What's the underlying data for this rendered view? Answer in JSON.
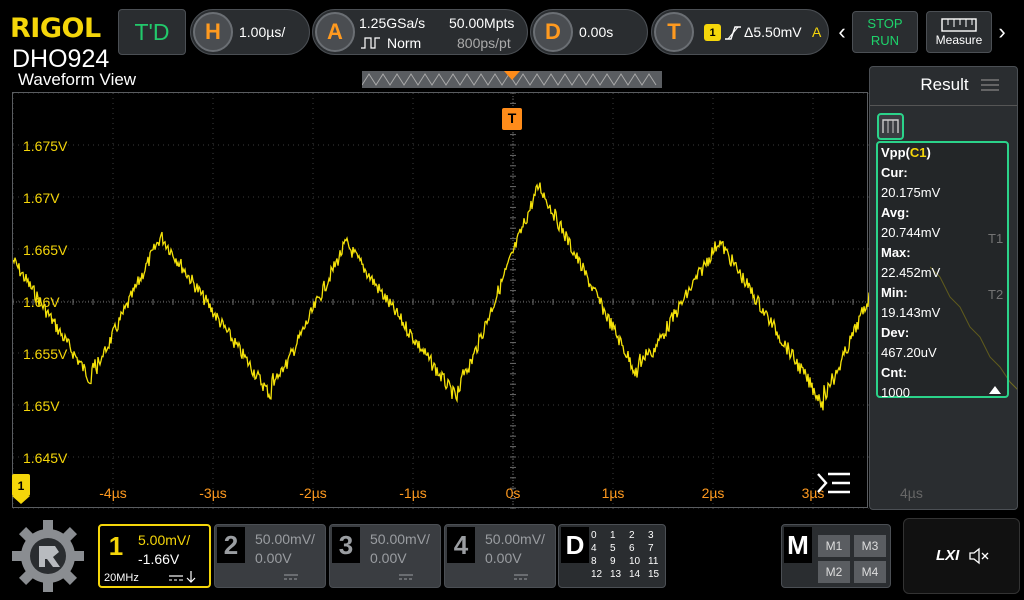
{
  "brand": {
    "logo": "RIGOL",
    "model": "DHO924"
  },
  "header": {
    "td_label": "T'D",
    "horizontal": {
      "key": "H",
      "timebase": "1.00µs/"
    },
    "acquire": {
      "key": "A",
      "sample_rate": "1.25GSa/s",
      "mode": "Norm",
      "memory_depth": "50.00Mpts",
      "sample_interval": "800ps/pt"
    },
    "delay": {
      "key": "D",
      "value": "0.00s"
    },
    "trigger": {
      "key": "T",
      "source": "1",
      "level": "Δ5.50mV",
      "sweep": "A"
    },
    "stop_label": "STOP",
    "run_label": "RUN",
    "measure_label": "Measure"
  },
  "waveform_view": {
    "title": "Waveform View",
    "trigger_badge": "T",
    "channel_marker": "1",
    "y_labels": [
      "1.675V",
      "1.67V",
      "1.665V",
      "1.66V",
      "1.655V",
      "1.65V",
      "1.645V"
    ],
    "x_labels": [
      "-4µs",
      "-3µs",
      "-2µs",
      "-1µs",
      "0s",
      "1µs",
      "2µs",
      "3µs"
    ],
    "ghost_x_label": "4µs"
  },
  "trace_color": "#f5e20a",
  "result": {
    "title": "Result",
    "measurement": "Vpp",
    "source": "C1",
    "rows": [
      {
        "label": "Cur:",
        "value": "20.175mV"
      },
      {
        "label": "Avg:",
        "value": "20.744mV"
      },
      {
        "label": "Max:",
        "value": "22.452mV"
      },
      {
        "label": "Min:",
        "value": "19.143mV"
      },
      {
        "label": "Dev:",
        "value": "467.20uV"
      },
      {
        "label": "Cnt:",
        "value": "1000"
      }
    ],
    "ghost_markers": [
      "T1",
      "T2"
    ]
  },
  "channels": [
    {
      "num": "1",
      "scale": "5.00mV/",
      "offset": "-1.66V",
      "bw": "20MHz",
      "active": true
    },
    {
      "num": "2",
      "scale": "50.00mV/",
      "offset": "0.00V",
      "active": false
    },
    {
      "num": "3",
      "scale": "50.00mV/",
      "offset": "0.00V",
      "active": false
    },
    {
      "num": "4",
      "scale": "50.00mV/",
      "offset": "0.00V",
      "active": false
    }
  ],
  "digital": {
    "label": "D",
    "bits": [
      "0",
      "1",
      "2",
      "3",
      "4",
      "5",
      "6",
      "7",
      "8",
      "9",
      "10",
      "11",
      "12",
      "13",
      "14",
      "15"
    ]
  },
  "math": {
    "label": "M",
    "m1": "M1",
    "m2": "M2",
    "m3": "M3",
    "m4": "M4"
  },
  "lxi": {
    "label": "LXI"
  }
}
